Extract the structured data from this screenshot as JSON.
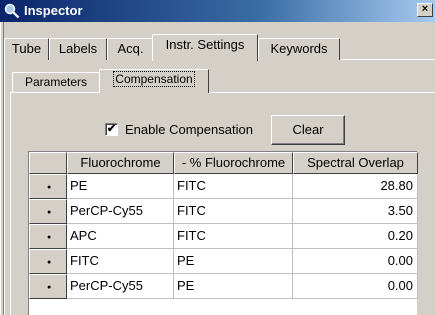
{
  "window": {
    "title": "Inspector",
    "close_glyph": "×",
    "icon": "magnifier-icon"
  },
  "outer_tabs": [
    {
      "label": "Tube"
    },
    {
      "label": "Labels"
    },
    {
      "label": "Acq."
    },
    {
      "label": "Instr. Settings",
      "active": true
    },
    {
      "label": "Keywords"
    }
  ],
  "inner_tabs": [
    {
      "label": "Parameters"
    },
    {
      "label": "Compensation",
      "active": true
    }
  ],
  "compensation": {
    "enable_label": "Enable Compensation",
    "enable_checked": true,
    "check_glyph": "✔",
    "clear_label": "Clear"
  },
  "grid": {
    "headers": [
      "Fluorochrome",
      "- % Fluorochrome",
      "Spectral Overlap"
    ],
    "row_marker": "●",
    "rows": [
      {
        "fluor": "PE",
        "minus": "FITC",
        "overlap": "28.80"
      },
      {
        "fluor": "PerCP-Cy55",
        "minus": "FITC",
        "overlap": "3.50"
      },
      {
        "fluor": "APC",
        "minus": "FITC",
        "overlap": "0.20"
      },
      {
        "fluor": "FITC",
        "minus": "PE",
        "overlap": "0.00"
      },
      {
        "fluor": "PerCP-Cy55",
        "minus": "PE",
        "overlap": "0.00"
      }
    ]
  }
}
